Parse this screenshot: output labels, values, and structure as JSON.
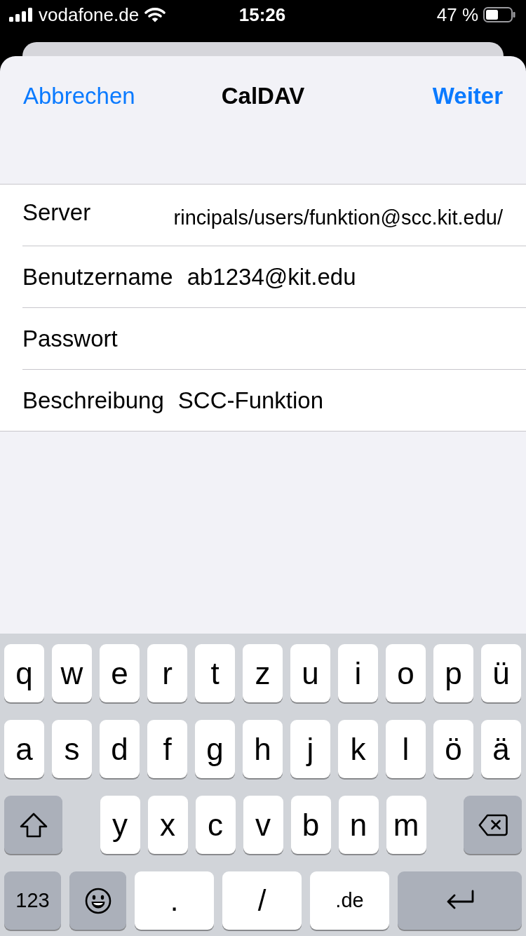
{
  "status_bar": {
    "carrier": "vodafone.de",
    "time": "15:26",
    "battery": "47 %"
  },
  "nav_bar": {
    "cancel": "Abbrechen",
    "title": "CalDAV",
    "next": "Weiter"
  },
  "form": [
    {
      "label": "Server",
      "kind": "url",
      "value": "rincipals/users/funktion@scc.kit.edu/"
    },
    {
      "label": "Benutzername",
      "kind": "text",
      "value": "ab1234@kit.edu"
    },
    {
      "label": "Passwort",
      "kind": "text"
    },
    {
      "label": "Beschreibung",
      "kind": "text",
      "value": "SCC-Funktion"
    }
  ],
  "keyboard": {
    "rows": [
      {
        "keys": [
          {
            "kind": "letter",
            "label": "q"
          },
          {
            "kind": "letter",
            "label": "w"
          },
          {
            "kind": "letter",
            "label": "e"
          },
          {
            "kind": "letter",
            "label": "r"
          },
          {
            "kind": "letter",
            "label": "t"
          },
          {
            "kind": "letter",
            "label": "z"
          },
          {
            "kind": "letter",
            "label": "u"
          },
          {
            "kind": "letter",
            "label": "i"
          },
          {
            "kind": "letter",
            "label": "o"
          },
          {
            "kind": "letter",
            "label": "p"
          },
          {
            "kind": "letter",
            "label": "ü"
          }
        ]
      },
      {
        "keys": [
          {
            "kind": "letter",
            "label": "a"
          },
          {
            "kind": "letter",
            "label": "s"
          },
          {
            "kind": "letter",
            "label": "d"
          },
          {
            "kind": "letter",
            "label": "f"
          },
          {
            "kind": "letter",
            "label": "g"
          },
          {
            "kind": "letter",
            "label": "h"
          },
          {
            "kind": "letter",
            "label": "j"
          },
          {
            "kind": "letter",
            "label": "k"
          },
          {
            "kind": "letter",
            "label": "l"
          },
          {
            "kind": "letter",
            "label": "ö"
          },
          {
            "kind": "letter",
            "label": "ä"
          }
        ]
      },
      {
        "keys": [
          {
            "kind": "shift"
          },
          {
            "kind": "letter",
            "label": "y"
          },
          {
            "kind": "letter",
            "label": "x"
          },
          {
            "kind": "letter",
            "label": "c"
          },
          {
            "kind": "letter",
            "label": "v"
          },
          {
            "kind": "letter",
            "label": "b"
          },
          {
            "kind": "letter",
            "label": "n"
          },
          {
            "kind": "letter",
            "label": "m"
          },
          {
            "kind": "delete"
          }
        ]
      },
      {
        "keys": [
          {
            "kind": "mode",
            "label": "123"
          },
          {
            "kind": "emoji"
          },
          {
            "kind": "punct",
            "label": "."
          },
          {
            "kind": "punct",
            "label": "/"
          },
          {
            "kind": "domain",
            "label": ".de"
          },
          {
            "kind": "return"
          }
        ]
      }
    ]
  }
}
